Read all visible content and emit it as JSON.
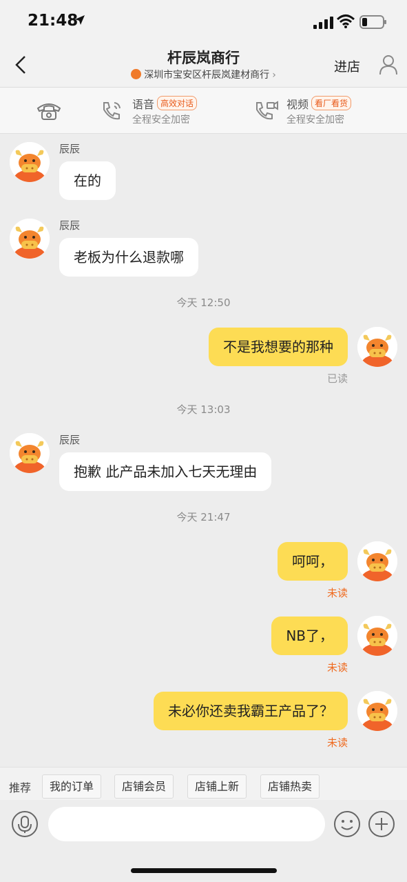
{
  "status_bar": {
    "time": "21:48"
  },
  "header": {
    "title": "杆辰岚商行",
    "subtitle": "深圳市宝安区杆辰岚建材商行",
    "subtitle_chevron": "›",
    "enter_store": "进店"
  },
  "call_bar": {
    "voice": {
      "title": "语音",
      "tag": "高效对话",
      "desc": "全程安全加密"
    },
    "video": {
      "title": "视频",
      "tag": "看厂看货",
      "desc": "全程安全加密"
    }
  },
  "messages": [
    {
      "sender": "辰辰",
      "text": "在的"
    },
    {
      "sender": "辰辰",
      "text": "老板为什么退款哪"
    },
    {
      "time": "今天 12:50"
    },
    {
      "text": "不是我想要的那种",
      "status": "已读"
    },
    {
      "time": "今天 13:03"
    },
    {
      "sender": "辰辰",
      "text": "抱歉 此产品未加入七天无理由"
    },
    {
      "time": "今天 21:47"
    },
    {
      "text": "呵呵，",
      "status": "未读"
    },
    {
      "text": "NB了，",
      "status": "未读"
    },
    {
      "text": "未必你还卖我霸王产品了？",
      "status": "未读"
    }
  ],
  "quick_bar": {
    "label": "推荐",
    "chips": [
      "我的订单",
      "店铺会员",
      "店铺上新",
      "店铺热卖"
    ]
  },
  "input": {
    "value": ""
  },
  "icons": {
    "back": "chevron-left-icon",
    "profile": "person-icon",
    "phone": "telephone-icon",
    "voice": "phone-call-icon",
    "video": "video-call-icon",
    "mic": "microphone-icon",
    "emoji": "emoji-icon",
    "plus": "plus-icon"
  },
  "colors": {
    "outgoing_bubble": "#fddc54",
    "incoming_bubble": "#ffffff",
    "unread": "#ef6a1f",
    "accent_tag": "#e85a1a"
  }
}
